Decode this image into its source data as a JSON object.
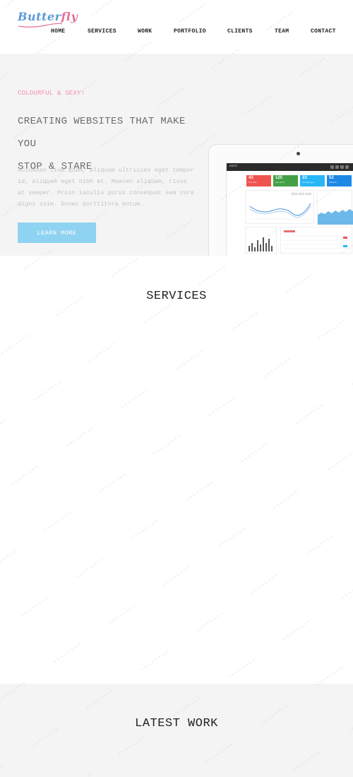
{
  "header": {
    "logo_part1": "Butter",
    "logo_part2": "fly",
    "nav": [
      {
        "label": "HOME"
      },
      {
        "label": "SERVICES"
      },
      {
        "label": "WORK"
      },
      {
        "label": "PORTFOLIO"
      },
      {
        "label": "CLIENTS"
      },
      {
        "label": "TEAM"
      },
      {
        "label": "CONTACT"
      }
    ]
  },
  "hero": {
    "tagline": "COLOURFUL & SEXY!",
    "headline_line1": "CREATING WEBSITES THAT MAKE YOU",
    "headline_line2": "STOP & STARE",
    "text": "Accumsan tium quam, aliquam ultricies eget tempor id, aliquam eget nibh et. Maecen aliquam, risus at semper. Proin iaculis purus consequat sem cure digni ssim. Donec porttitora entum.",
    "cta_label": "LEARN MORE",
    "mockup": {
      "brand": "WEST",
      "stats": [
        {
          "value": "43",
          "label": "New Visits",
          "color": "#ef5350"
        },
        {
          "value": "125",
          "label": "New Orders",
          "color": "#43a047"
        },
        {
          "value": "23",
          "label": "New Messages",
          "color": "#29b6f6"
        },
        {
          "value": "52",
          "label": "Followers",
          "color": "#1e88e5"
        }
      ]
    }
  },
  "services": {
    "title": "SERVICES"
  },
  "latest_work": {
    "title": "LATEST WORK"
  },
  "colors": {
    "accent_blue": "#8fd3f2",
    "accent_pink": "#f48fb1",
    "logo_blue": "#5a9bd5",
    "logo_pink": "#e36f9b"
  }
}
